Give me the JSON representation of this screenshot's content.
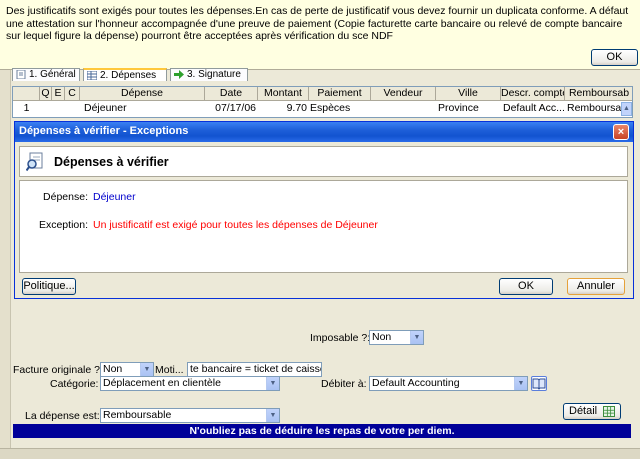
{
  "alert": {
    "message": "Des justificatifs sont exigés pour toutes les dépenses.En cas de perte de justificatif vous devez fournir un duplicata conforme. A défaut une attestation sur l'honneur accompagnée d'une preuve de paiement (Copie facturette carte bancaire ou relevé de compte bancaire sur lequel figure la dépense) pourront être acceptées après vérification du sce NDF",
    "ok_label": "OK"
  },
  "tabs": [
    {
      "label": "1. Général"
    },
    {
      "label": "2. Dépenses"
    },
    {
      "label": "3. Signature"
    }
  ],
  "grid": {
    "columns": [
      "",
      "Q",
      "E",
      "C",
      "Dépense",
      "Date",
      "Montant",
      "Paiement",
      "Vendeur",
      "Ville",
      "Descr. compte",
      "Remboursab"
    ],
    "rows": [
      [
        "1",
        "",
        "",
        "",
        "Déjeuner",
        "07/17/06",
        "9.70",
        "Espèces",
        "",
        "Province",
        "Default Acc...",
        "Remboursab"
      ]
    ]
  },
  "dialog": {
    "title": "Dépenses à vérifier - Exceptions",
    "close_label": "×",
    "header": "Dépenses à vérifier",
    "depense_label": "Dépense:",
    "depense_value": "Déjeuner",
    "exception_label": "Exception:",
    "exception_value": "Un justificatif est exigé pour toutes les dépenses de Déjeuner",
    "politique_label": "Politique...",
    "ok_label": "OK",
    "annuler_label": "Annuler"
  },
  "form": {
    "imposable_label": "Imposable ?:",
    "imposable_value": "Non",
    "facture_label": "Facture originale ?:",
    "facture_value": "Non",
    "motif_label": "Moti...",
    "motif_value": "te bancaire = ticket de caisse",
    "categorie_label": "Catégorie:",
    "categorie_value": "Déplacement en clientèle",
    "debiter_label": "Débiter à:",
    "debiter_value": "Default Accounting",
    "depense_est_label": "La dépense est:",
    "depense_est_value": "Remboursable",
    "detail_label": "Détail",
    "banner": "N'oubliez pas de déduire les repas de votre per diem."
  },
  "colors": {
    "alert_bg": "#FFFFE1",
    "dialog_title": "#1E5FD9",
    "link_blue": "#0000CC",
    "exception_red": "#FF0000",
    "banner_bg": "#000099"
  }
}
